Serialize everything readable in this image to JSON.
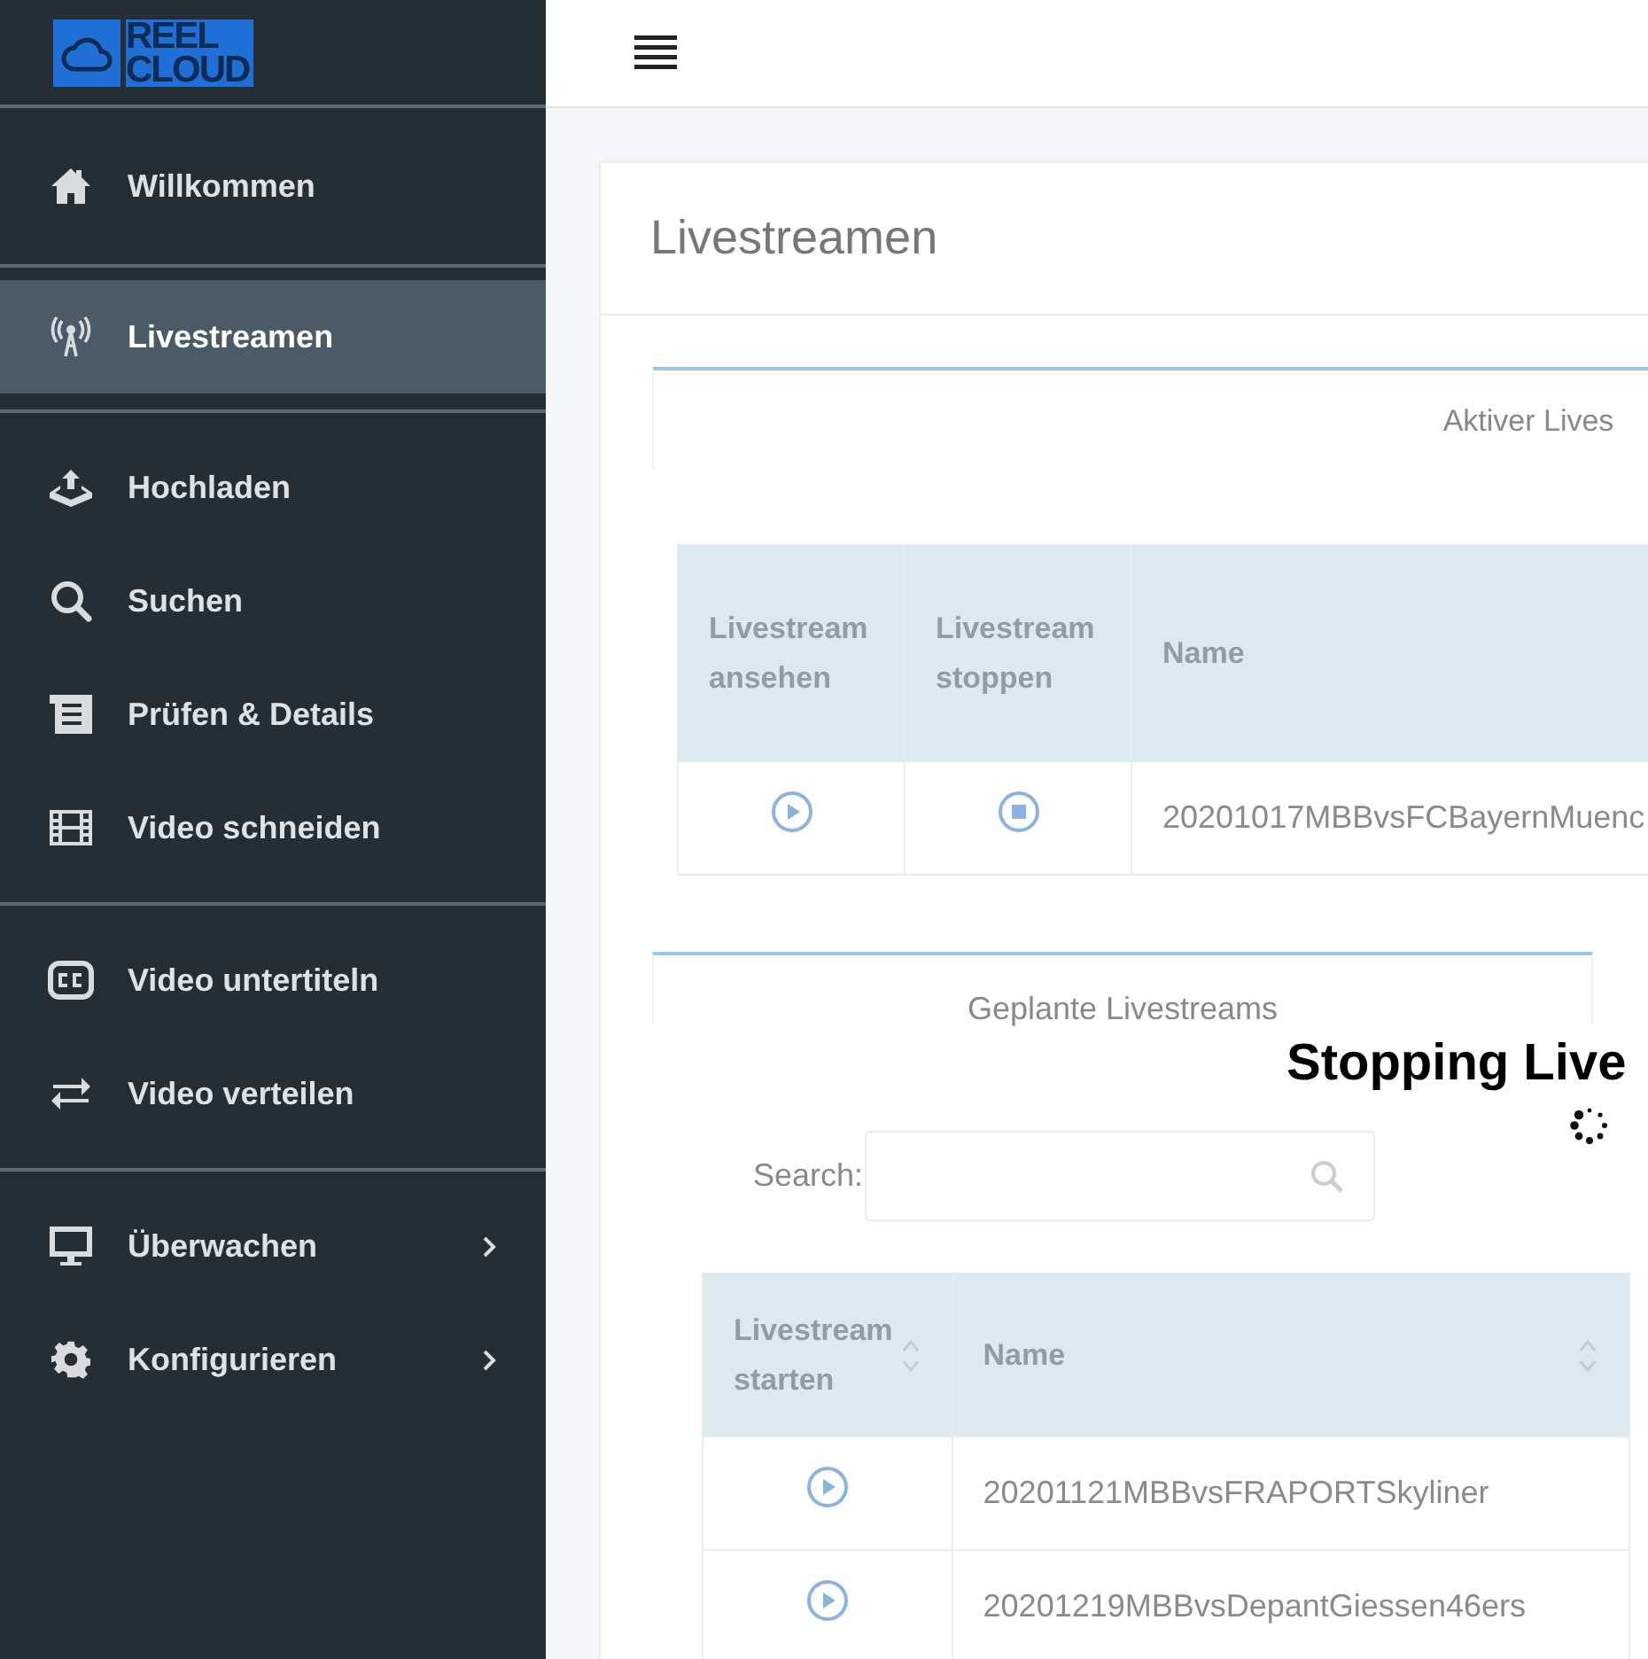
{
  "sidebar": {
    "logo": {
      "line_1": "REEL",
      "line_2": "CLOUD"
    },
    "groups": [
      [
        {
          "label": "Willkommen",
          "selected": false,
          "submenu": false
        }
      ],
      [
        {
          "label": "Livestreamen",
          "selected": true,
          "submenu": false
        }
      ],
      [
        {
          "label": "Hochladen",
          "selected": false,
          "submenu": false
        },
        {
          "label": "Suchen",
          "selected": false,
          "submenu": false
        },
        {
          "label": "Prüfen & Details",
          "selected": false,
          "submenu": false
        },
        {
          "label": "Video schneiden",
          "selected": false,
          "submenu": false
        }
      ],
      [
        {
          "label": "Video untertiteln",
          "selected": false,
          "submenu": false
        },
        {
          "label": "Video verteilen",
          "selected": false,
          "submenu": false
        }
      ],
      [
        {
          "label": "Überwachen",
          "selected": false,
          "submenu": true
        },
        {
          "label": "Konfigurieren",
          "selected": false,
          "submenu": true
        }
      ]
    ]
  },
  "page": {
    "title": "Livestreamen"
  },
  "active_section": {
    "tab": "Aktiver Lives",
    "table": {
      "columns": [
        {
          "label": "Livestream ansehen",
          "sortable": false
        },
        {
          "label": "Livestream stoppen",
          "sortable": false
        },
        {
          "label": "Name",
          "sortable": false
        }
      ],
      "rows": [
        {
          "cells": [
            {
              "kind": "play"
            },
            {
              "kind": "stop"
            },
            {
              "kind": "text",
              "text": "20201017MBBvsFCBayernMuenc"
            }
          ]
        }
      ]
    }
  },
  "scheduled_section": {
    "tab": "Geplante Livestreams",
    "search": {
      "label": "Search:"
    },
    "table": {
      "columns": [
        {
          "label": "Livestream starten",
          "sortable": true
        },
        {
          "label": "Name",
          "sortable": true
        }
      ],
      "rows": [
        {
          "cells": [
            {
              "kind": "play"
            },
            {
              "kind": "text",
              "text": "20201121MBBvsFRAPORTSkyliner"
            }
          ]
        },
        {
          "cells": [
            {
              "kind": "play"
            },
            {
              "kind": "text",
              "text": "20201219MBBvsDepantGiessen46ers"
            }
          ]
        }
      ]
    }
  },
  "overlay": {
    "title": "Stopping Live"
  }
}
